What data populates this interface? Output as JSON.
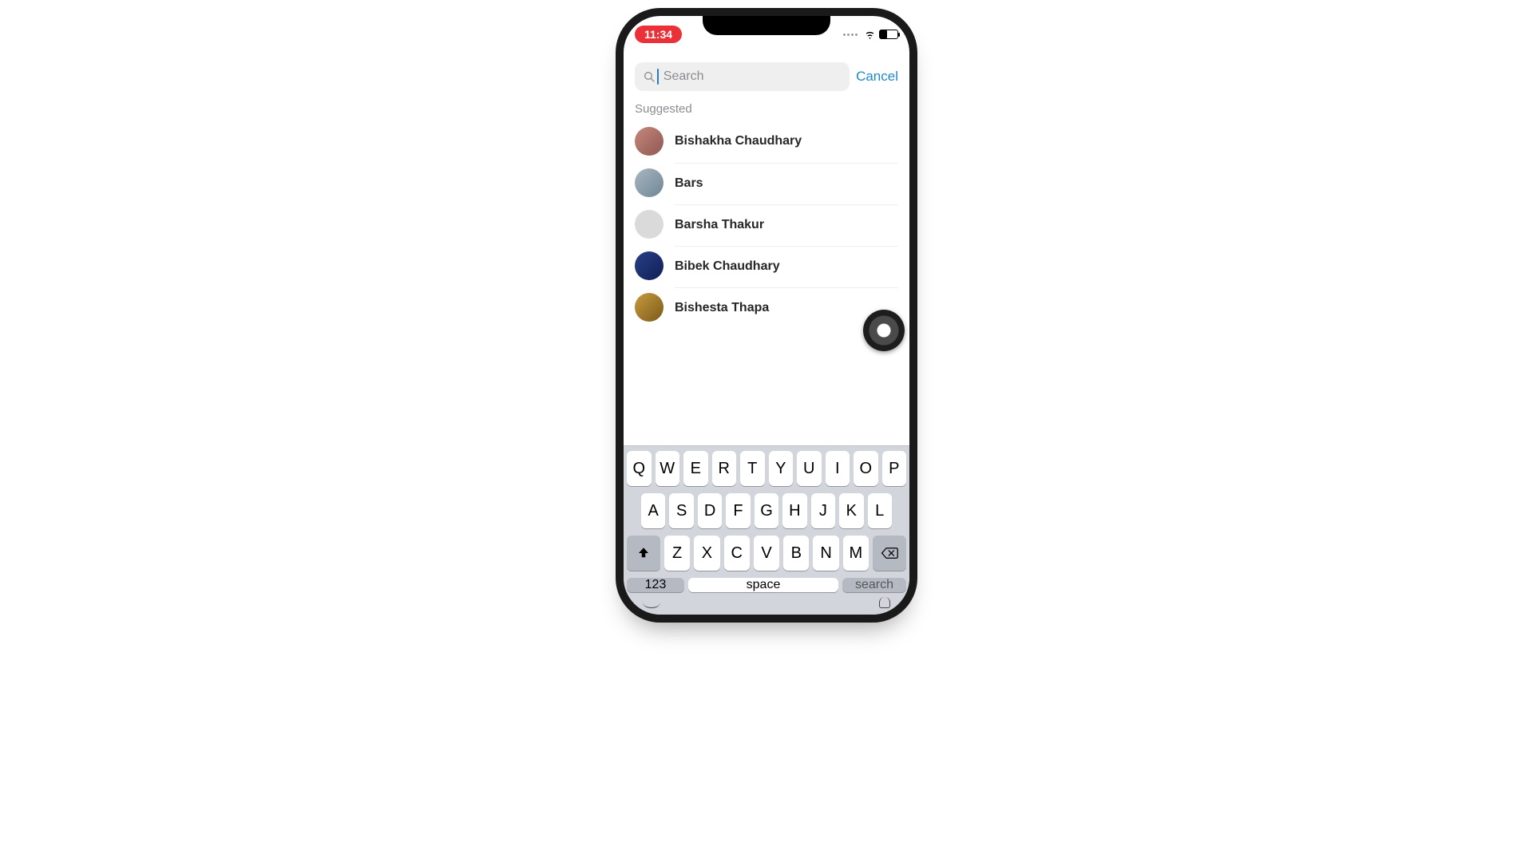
{
  "status": {
    "time": "11:34"
  },
  "search": {
    "placeholder": "Search",
    "value": "",
    "cancel": "Cancel"
  },
  "section_title": "Suggested",
  "contacts": [
    {
      "name": "Bishakha Chaudhary",
      "avatar_bg": "linear-gradient(135deg,#c6877a,#8e5853)"
    },
    {
      "name": "Bars",
      "avatar_bg": "linear-gradient(135deg,#a8b7c2,#6f8694)"
    },
    {
      "name": "Barsha Thakur",
      "avatar_bg": "#dadada"
    },
    {
      "name": "Bibek Chaudhary",
      "avatar_bg": "linear-gradient(135deg,#2a3f87,#0f1f55)"
    },
    {
      "name": "Bishesta Thapa",
      "avatar_bg": "linear-gradient(135deg,#c99b3f,#7a5a19)"
    }
  ],
  "keyboard": {
    "row1": [
      "Q",
      "W",
      "E",
      "R",
      "T",
      "Y",
      "U",
      "I",
      "O",
      "P"
    ],
    "row2": [
      "A",
      "S",
      "D",
      "F",
      "G",
      "H",
      "J",
      "K",
      "L"
    ],
    "row3": [
      "Z",
      "X",
      "C",
      "V",
      "B",
      "N",
      "M"
    ],
    "numeric_label": "123",
    "space_label": "space",
    "action_label": "search"
  }
}
